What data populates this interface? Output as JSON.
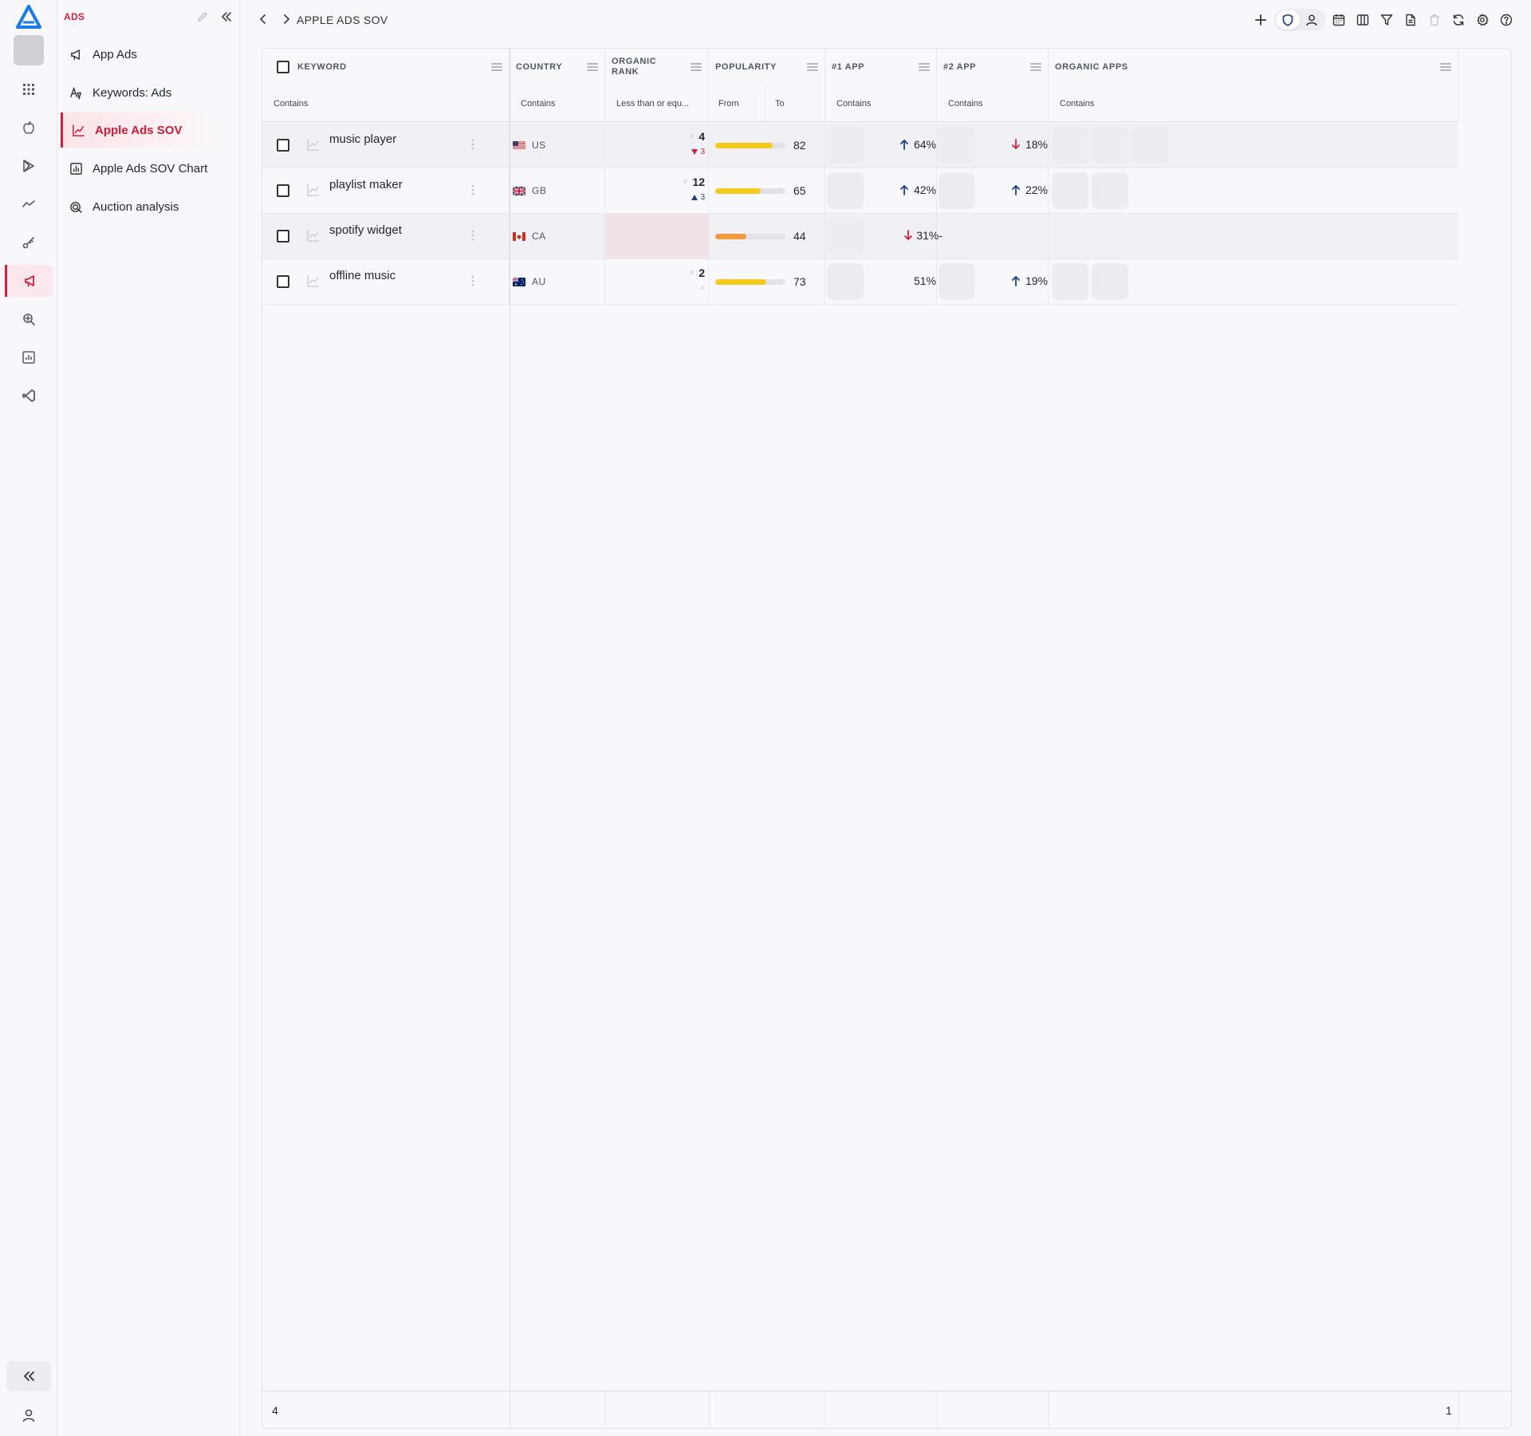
{
  "nav": {
    "section_title": "ADS",
    "items": [
      {
        "label": "App Ads",
        "icon": "megaphone-icon"
      },
      {
        "label": "Keywords: Ads",
        "icon": "keyword-ads-icon"
      },
      {
        "label": "Apple Ads SOV",
        "icon": "line-chart-icon",
        "active": true
      },
      {
        "label": "Apple Ads SOV Chart",
        "icon": "bar-chart-icon"
      },
      {
        "label": "Auction analysis",
        "icon": "auction-icon"
      }
    ]
  },
  "rail": {
    "icons": [
      "apps-grid-icon",
      "apple-icon",
      "google-play-icon",
      "trend-icon",
      "key-icon",
      "megaphone-icon",
      "search-settings-icon",
      "report-icon",
      "vscode-icon"
    ],
    "active_index": 5
  },
  "topbar": {
    "breadcrumb": "APPLE ADS SOV",
    "tools": [
      "add-icon",
      "shield-icon",
      "user-icon",
      "calendar-icon",
      "columns-icon",
      "filter-icon",
      "export-icon",
      "delete-icon",
      "refresh-icon",
      "settings-icon",
      "help-icon"
    ]
  },
  "grid": {
    "columns": {
      "keyword": "KEYWORD",
      "country": "COUNTRY",
      "organic_rank": "ORGANIC RANK",
      "popularity": "POPULARITY",
      "app1": "#1 APP",
      "app2": "#2 APP",
      "organic_apps": "ORGANIC APPS"
    },
    "filters": {
      "keyword": "Contains",
      "country": "Contains",
      "organic_rank": "Less than or equ...",
      "popularity_from": "From",
      "popularity_to": "To",
      "app1": "Contains",
      "app2": "Contains",
      "organic_apps": "Contains"
    },
    "rows": [
      {
        "keyword": "music player",
        "country": "US",
        "rank_hash": "#",
        "rank": "4",
        "rank_change": "3",
        "rank_dir": "down",
        "popularity": "82",
        "pop_color": "#f4cb1c",
        "sov1_dir": "up",
        "sov1": "64%",
        "sov2_dir": "down",
        "sov2": "18%"
      },
      {
        "keyword": "playlist maker",
        "country": "GB",
        "rank_hash": "#",
        "rank": "12",
        "rank_change": "3",
        "rank_dir": "up",
        "popularity": "65",
        "pop_color": "#f4cb1c",
        "sov1_dir": "up",
        "sov1": "42%",
        "sov2_dir": "up",
        "sov2": "22%"
      },
      {
        "keyword": "spotify widget",
        "country": "CA",
        "popularity": "44",
        "pop_color": "#f59a3e",
        "sov1_dir": "down",
        "sov1": "31%",
        "sov1_suffix": "-"
      },
      {
        "keyword": "offline music",
        "country": "AU",
        "rank_hash": "#",
        "rank": "2",
        "rank_change": "=",
        "rank_dir": "none",
        "popularity": "73",
        "pop_color": "#f4cb1c",
        "sov1": "51%",
        "sov2_dir": "up",
        "sov2": "19%"
      }
    ],
    "footer": {
      "count": "4",
      "page": "1"
    }
  },
  "colors": {
    "accent": "#d21f3c",
    "up": "#1d3d8a",
    "down": "#d21f3c"
  }
}
